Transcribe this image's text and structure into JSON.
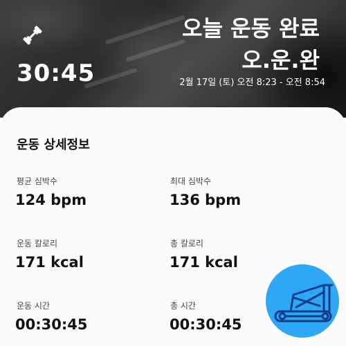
{
  "header": {
    "timer": "30:45",
    "title": "오늘 운동 완료",
    "subtitle": "오.운.완",
    "date_range": "2월 17일 (토) 오전 8:23 - 오전 8:54",
    "icon": "dumbbell-icon"
  },
  "details": {
    "title": "운동 상세정보",
    "stats": [
      {
        "label": "평균 심박수",
        "value": "124 bpm"
      },
      {
        "label": "최대 심박수",
        "value": "136 bpm"
      },
      {
        "label": "운동 칼로리",
        "value": "171 kcal"
      },
      {
        "label": "총 칼로리",
        "value": "171 kcal"
      },
      {
        "label": "운동 시간",
        "value": "00:30:45"
      },
      {
        "label": "총 시간",
        "value": "00:30:45"
      }
    ]
  },
  "fab": {
    "icon": "treadmill-icon",
    "color": "#2ea8f5"
  }
}
